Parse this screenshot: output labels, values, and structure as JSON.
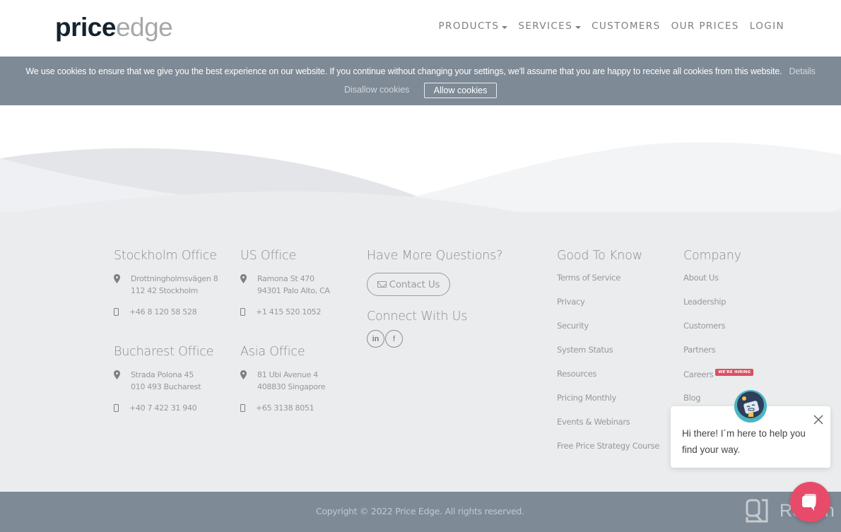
{
  "header": {
    "logo_bold": "price",
    "logo_light": "edge",
    "nav": [
      {
        "label": "PRODUCTS",
        "dropdown": true
      },
      {
        "label": "SERVICES",
        "dropdown": true
      },
      {
        "label": "CUSTOMERS",
        "dropdown": false
      },
      {
        "label": "OUR PRICES",
        "dropdown": false
      },
      {
        "label": "LOGIN",
        "dropdown": false
      }
    ]
  },
  "cookie_bar": {
    "message": "We use cookies to ensure that we give you the best experience on our website. If you continue without changing your settings, we'll assume that you are happy to receive all cookies from this website.",
    "details_label": "Details",
    "disallow_label": "Disallow cookies",
    "allow_label": "Allow cookies"
  },
  "offices": [
    {
      "title": "Stockholm Office",
      "address_line1": "Drottningholmsvägen 8",
      "address_line2": "112 42 Stockholm",
      "phone": "+46 8 120 58 528"
    },
    {
      "title": "US Office",
      "address_line1": "Ramona St 470",
      "address_line2": "94301 Palo Alto, CA",
      "phone": "+1 415 520 1052"
    },
    {
      "title": "Bucharest Office",
      "address_line1": "Strada Polona 45",
      "address_line2": "010 493 Bucharest",
      "phone": "+40 7 422 31 940"
    },
    {
      "title": "Asia Office",
      "address_line1": "81 Ubi Avenue 4",
      "address_line2": "408830 Singapore",
      "phone": "+65 3138 8051"
    }
  ],
  "questions": {
    "title": "Have More Questions?",
    "contact_label": "Contact Us",
    "connect_title": "Connect With Us",
    "social": [
      {
        "name": "linkedin",
        "glyph": "in"
      },
      {
        "name": "facebook",
        "glyph": "f"
      }
    ]
  },
  "good_to_know": {
    "title": "Good To Know",
    "links": [
      "Terms of Service",
      "Privacy",
      "Security",
      "System Status",
      "Resources",
      "Pricing Monthly",
      "Events & Webinars",
      "Free Price Strategy Course"
    ]
  },
  "company": {
    "title": "Company",
    "links": [
      "About Us",
      "Leadership",
      "Customers",
      "Partners",
      "Careers",
      "Blog"
    ],
    "careers_badge": "WE'RE HIRING"
  },
  "footer": {
    "copyright": "Copyright © 2022 Price Edge. All rights reserved.",
    "watermark": "Revain"
  },
  "chat": {
    "message": "Hi there! I´m here to help you find your way."
  },
  "colors": {
    "bar_bg": "#7e8a96",
    "footer_bg": "#eaecee",
    "badge": "#dc4f60",
    "chat_launcher": "#e84b6a",
    "logo_dark": "#13232f"
  }
}
